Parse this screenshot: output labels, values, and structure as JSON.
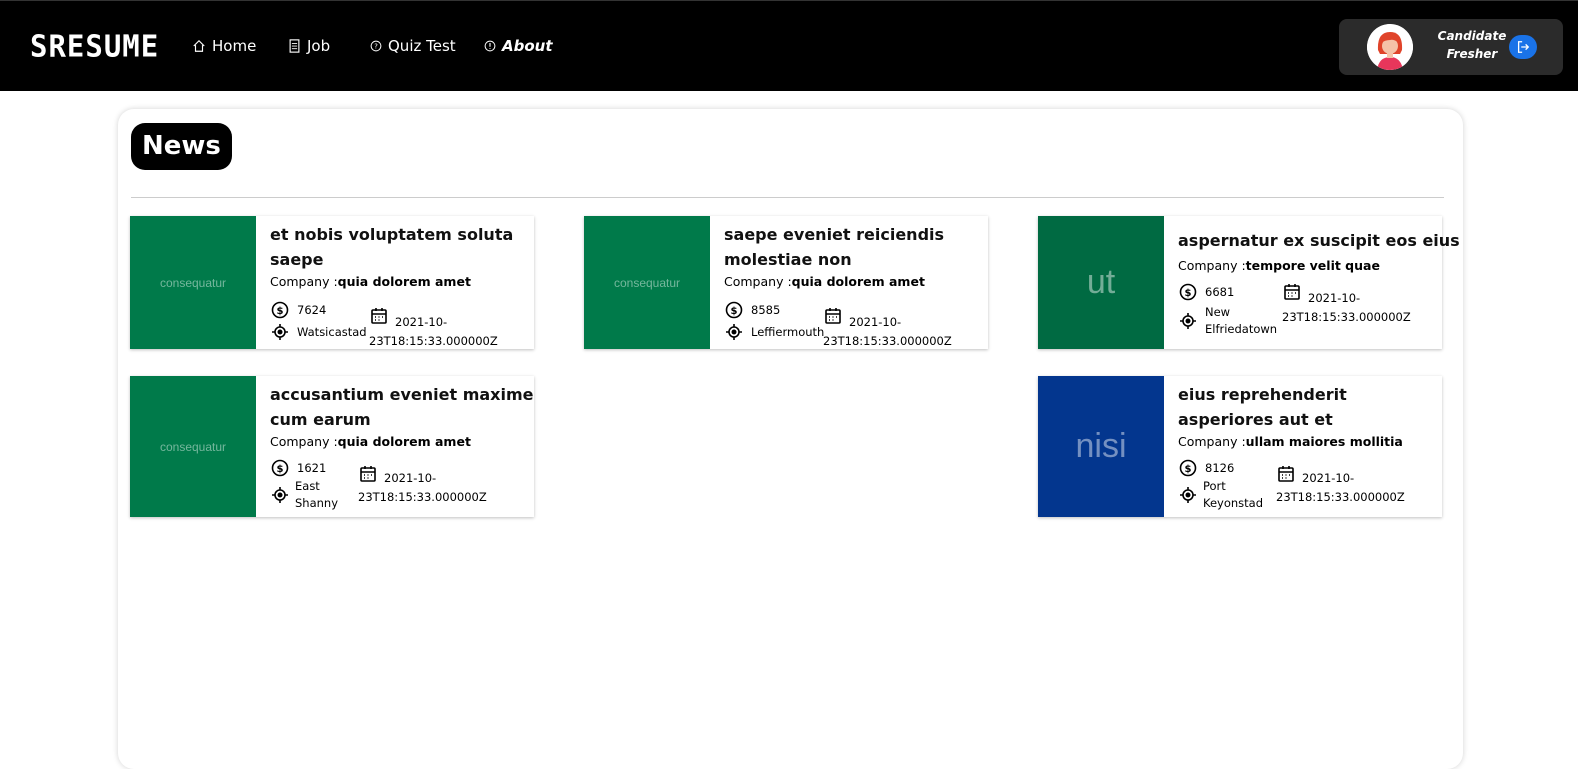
{
  "brand": "SRESUME",
  "nav": [
    {
      "label": "Home",
      "icon": "home-icon"
    },
    {
      "label": "Job",
      "icon": "document-icon"
    },
    {
      "label": "Quiz Test",
      "icon": "question-circle-icon"
    },
    {
      "label": "About",
      "icon": "info-circle-icon"
    }
  ],
  "user": {
    "role": "Candidate",
    "level": "Fresher",
    "logout_icon": "logout-icon",
    "accent": "#1a73e8"
  },
  "page": {
    "title": "News"
  },
  "company_prefix": "Company :",
  "news": [
    {
      "title": "et nobis voluptatem soluta saepe",
      "company": "quia dolorem amet",
      "salary": "7624",
      "location": "Watsicastad",
      "date": "2021-10-23T18:15:33.000000Z",
      "image_text": "consequatur",
      "image_color": "#007a4a"
    },
    {
      "title": "saepe eveniet reiciendis molestiae non",
      "company": "quia dolorem amet",
      "salary": "8585",
      "location": "Leffiermouth",
      "date": "2021-10-23T18:15:33.000000Z",
      "image_text": "consequatur",
      "image_color": "#007a4a"
    },
    {
      "title": "aspernatur ex suscipit eos eius",
      "company": "tempore velit quae",
      "salary": "6681",
      "location": "New Elfriedatown",
      "date": "2021-10-23T18:15:33.000000Z",
      "image_text": "ut",
      "image_color": "#006a42"
    },
    {
      "title": "accusantium eveniet maxime cum earum",
      "company": "quia dolorem amet",
      "salary": "1621",
      "location": "East Shanny",
      "date": "2021-10-23T18:15:33.000000Z",
      "image_text": "consequatur",
      "image_color": "#007a4a"
    },
    {
      "title": "eius reprehenderit asperiores aut et",
      "company": "ullam maiores mollitia",
      "salary": "8126",
      "location": "Port Keyonstad",
      "date": "2021-10-23T18:15:33.000000Z",
      "image_text": "nisi",
      "image_color": "#03368e"
    }
  ]
}
